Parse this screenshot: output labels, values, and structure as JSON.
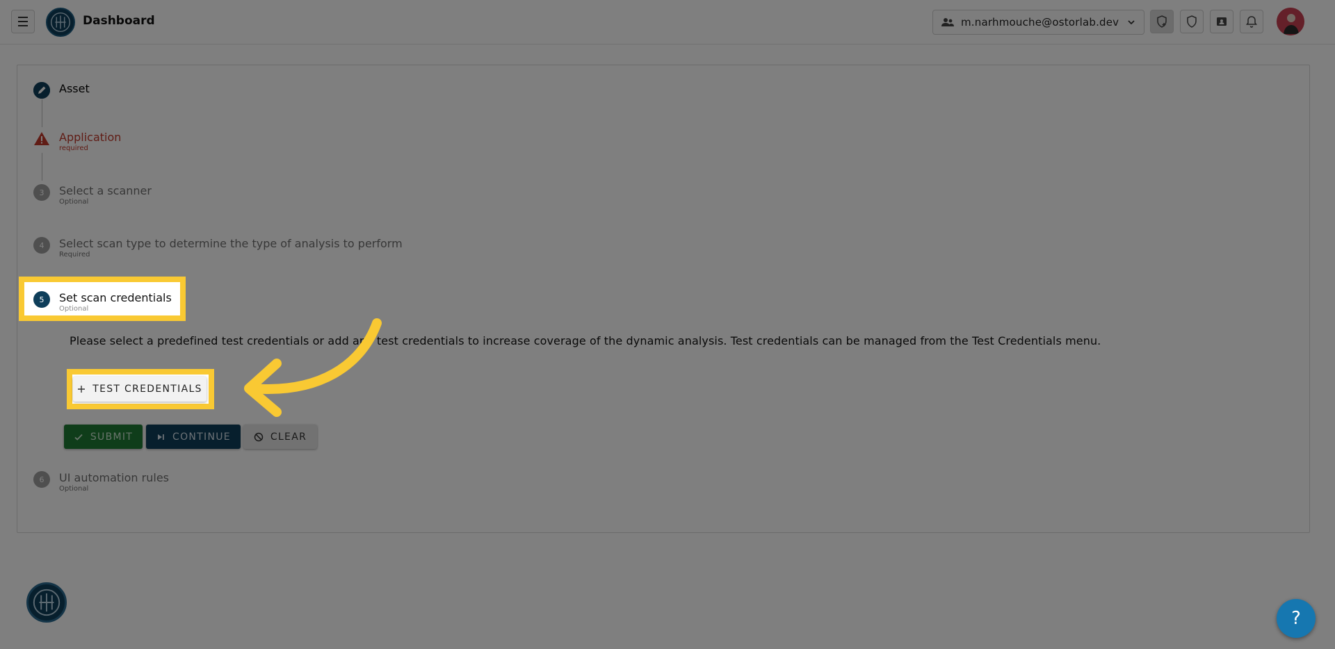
{
  "header": {
    "title": "Dashboard",
    "account_email": "m.narhmouche@ostorlab.dev"
  },
  "steps": [
    {
      "number": "",
      "label": "Asset",
      "sub": ""
    },
    {
      "number": "",
      "label": "Application",
      "sub": "required"
    },
    {
      "number": "3",
      "label": "Select a scanner",
      "sub": "Optional"
    },
    {
      "number": "4",
      "label": "Select scan type to determine the type of analysis to perform",
      "sub": "Required"
    },
    {
      "number": "5",
      "label": "Set scan credentials",
      "sub": "Optional"
    },
    {
      "number": "6",
      "label": "UI automation rules",
      "sub": "Optional"
    }
  ],
  "credentials": {
    "description": "Please select a predefined test credentials or add any test credentials to increase coverage of the dynamic analysis. Test credentials can be managed from the Test Credentials menu.",
    "add_button": "TEST CREDENTIALS"
  },
  "actions": {
    "submit": "SUBMIT",
    "continue": "CONTINUE",
    "clear": "CLEAR"
  },
  "help": {
    "label": "?"
  },
  "colors": {
    "highlight": "#f9c933",
    "primary": "#0e3e5a",
    "success": "#1e7a35",
    "error": "#c0392b",
    "help": "#1677b0"
  }
}
